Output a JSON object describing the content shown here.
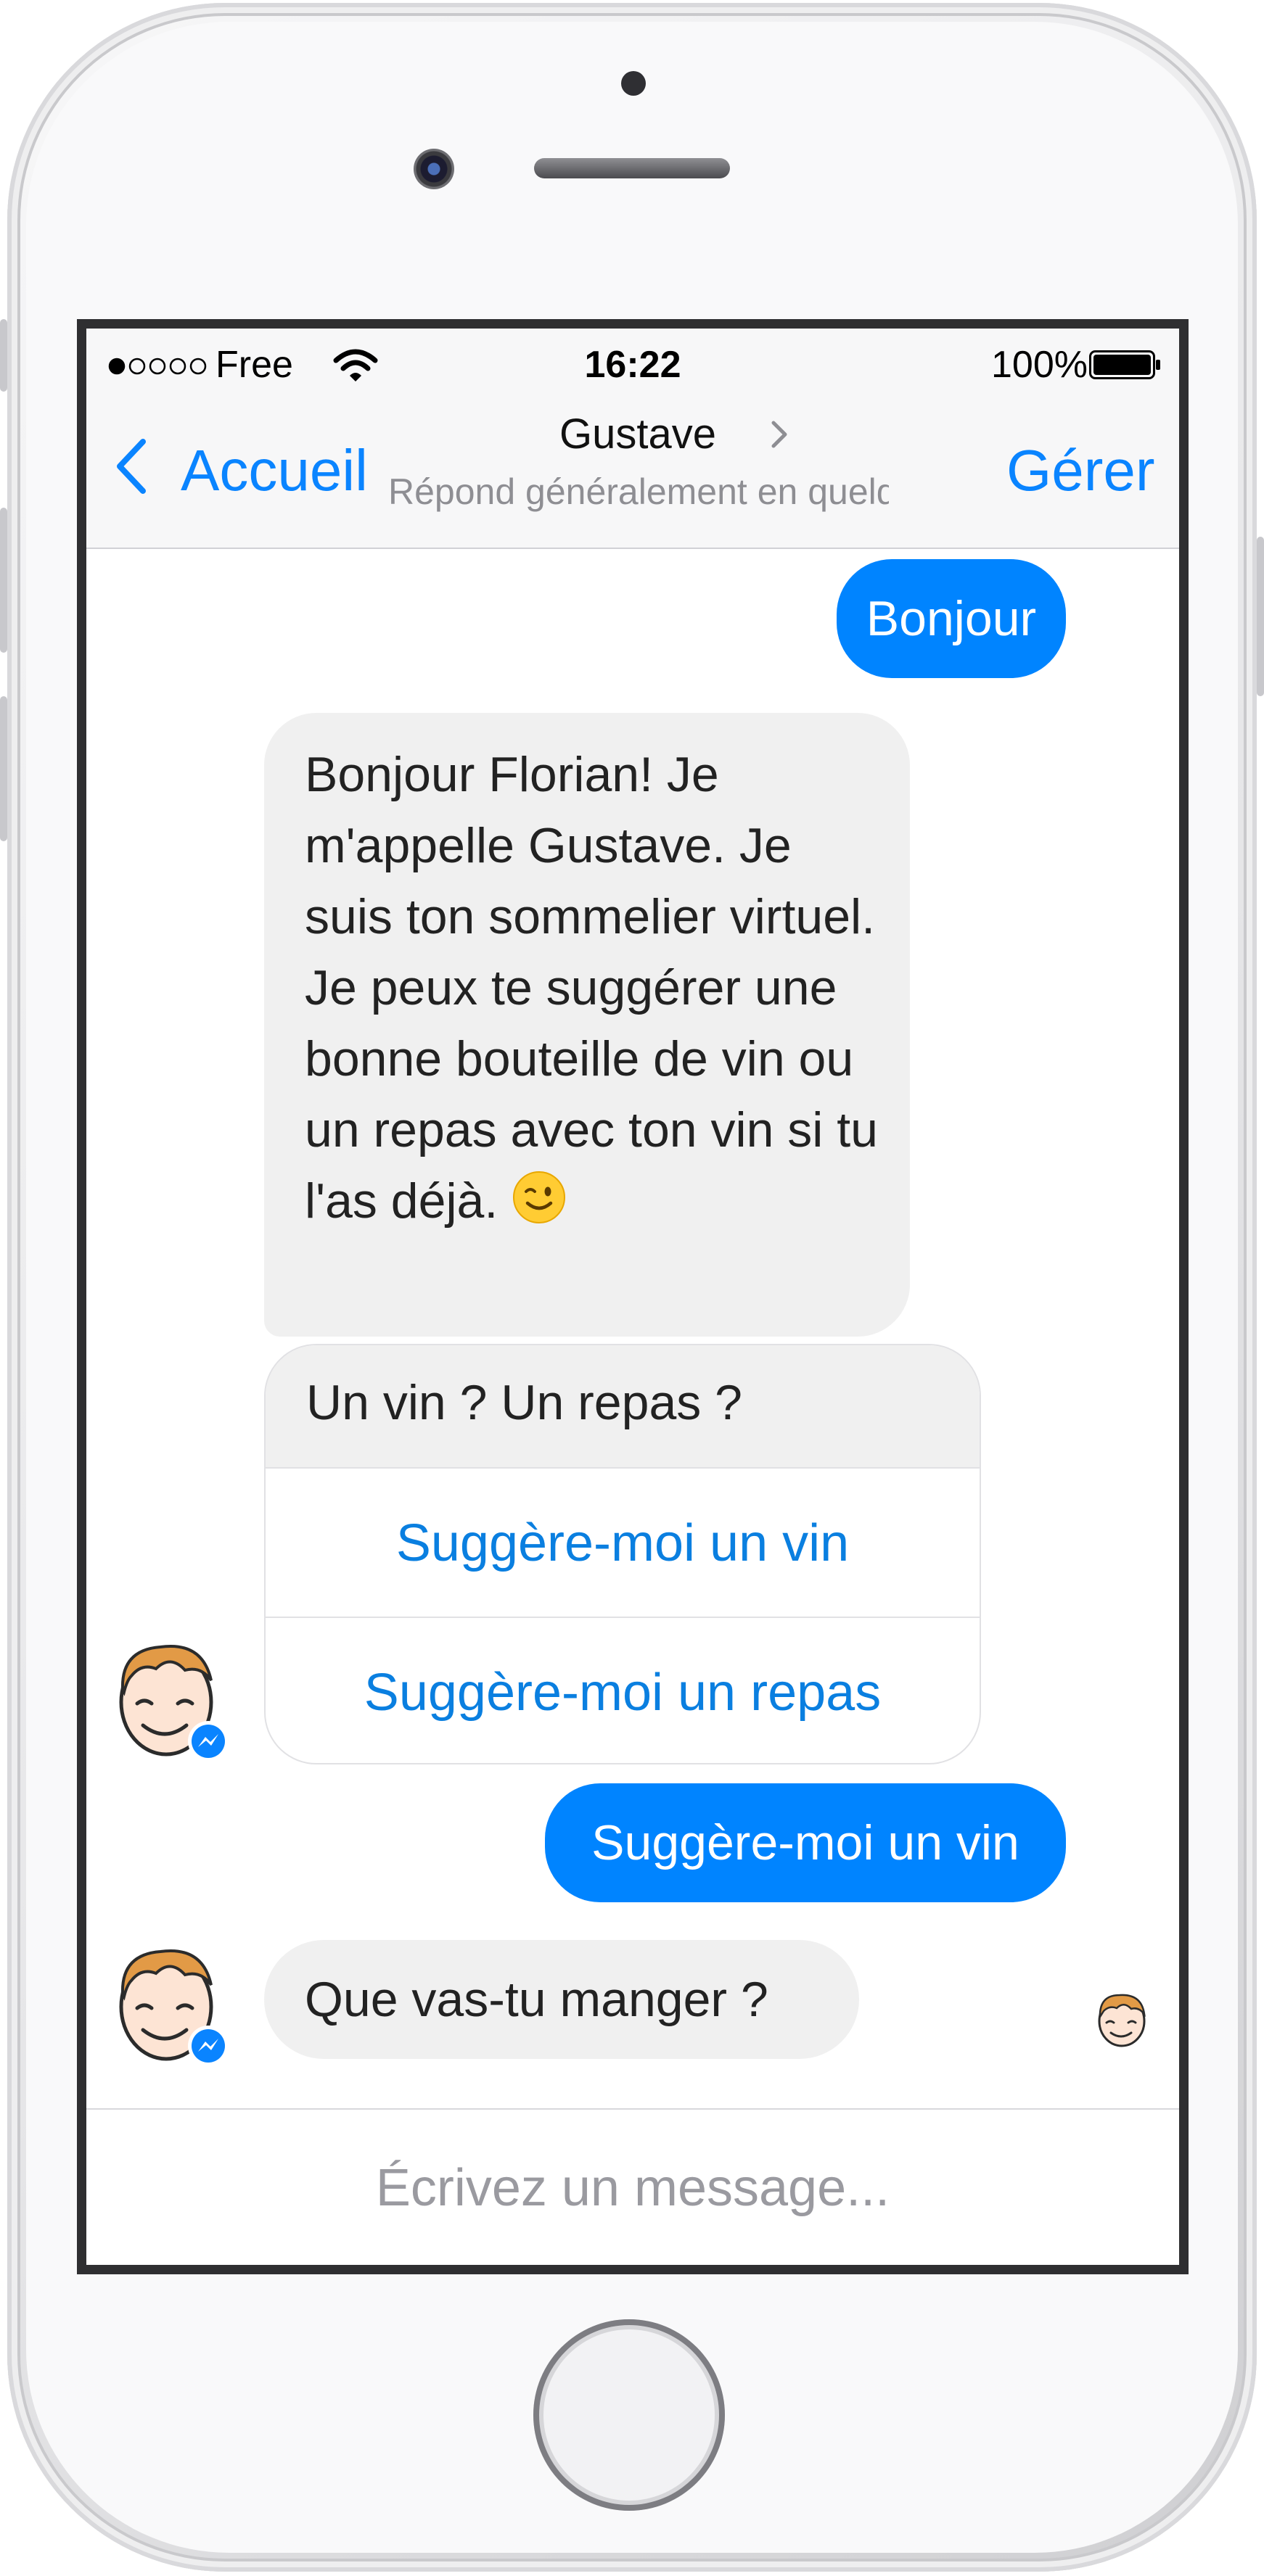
{
  "status_bar": {
    "carrier": "Free",
    "time": "16:22",
    "battery_percent": "100%",
    "signal_bars": 1,
    "signal_total": 5
  },
  "nav": {
    "back_label": "Accueil",
    "contact_name": "Gustave",
    "contact_subtitle": "Répond généralement en quelq...",
    "manage_label": "Gérer"
  },
  "messages": [
    {
      "from": "user",
      "text": "Bonjour"
    },
    {
      "from": "bot",
      "text": "Bonjour Florian! Je m'appelle Gustave. Je suis ton sommelier virtuel. Je peux te suggérer une bonne bouteille de vin ou un repas avec ton vin si tu l'as déjà."
    },
    {
      "from": "user",
      "text": "Suggère-moi un vin"
    },
    {
      "from": "bot",
      "text": "Que vas-tu manger ?"
    }
  ],
  "card": {
    "title": "Un vin ? Un repas ?",
    "buttons": [
      "Suggère-moi un vin",
      "Suggère-moi un repas"
    ]
  },
  "composer": {
    "placeholder": "Écrivez un message..."
  },
  "colors": {
    "accent": "#0a84ff",
    "outgoing_bubble": "#0084ff",
    "incoming_bubble": "#f0f0f0"
  },
  "icons": [
    "back-chevron-icon",
    "wifi-icon",
    "battery-icon",
    "chevron-right-icon",
    "wink-emoji-icon",
    "messenger-badge-icon"
  ]
}
